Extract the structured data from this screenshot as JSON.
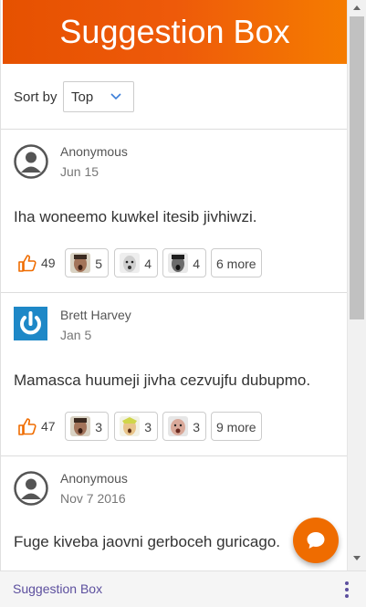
{
  "header": {
    "title": "Suggestion Box"
  },
  "sort": {
    "label": "Sort by",
    "value": "Top"
  },
  "suggestions": [
    {
      "author": "Anonymous",
      "date": "Jun 15",
      "avatar": "anonymous-avatar-icon",
      "text": "Iha woneemo kuwkel itesib jivhiwzi.",
      "likes": "49",
      "reactions": [
        {
          "face": "face-emoji-a",
          "count": "5"
        },
        {
          "face": "face-emoji-b",
          "count": "4"
        },
        {
          "face": "face-emoji-c",
          "count": "4"
        }
      ],
      "more": "6 more"
    },
    {
      "author": "Brett Harvey",
      "date": "Jan 5",
      "avatar": "power-logo-avatar",
      "text": "Mamasca huumeji jivha cezvujfu dubupmo.",
      "likes": "47",
      "reactions": [
        {
          "face": "face-emoji-a",
          "count": "3"
        },
        {
          "face": "face-emoji-d",
          "count": "3"
        },
        {
          "face": "face-emoji-e",
          "count": "3"
        }
      ],
      "more": "9 more"
    },
    {
      "author": "Anonymous",
      "date": "Nov 7 2016",
      "avatar": "anonymous-avatar-icon",
      "text": "Fuge kiveba jaovni gerboceh guricago."
    }
  ],
  "footer": {
    "title": "Suggestion Box"
  },
  "colors": {
    "accent": "#ef6c00",
    "footer_text": "#5c4f9e",
    "like": "#ef6c00"
  }
}
